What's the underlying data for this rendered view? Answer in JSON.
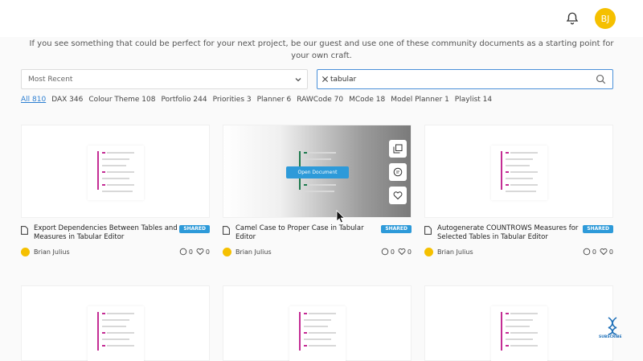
{
  "header": {
    "bell_icon": "bell-icon",
    "avatar_initials": "BJ"
  },
  "intro": "If you see something that could be perfect for your next project, be our guest and use one of these community documents as a starting point for your own craft.",
  "sort_select": {
    "value": "Most Recent"
  },
  "search": {
    "value": "tabular"
  },
  "filters": [
    {
      "label": "All 810",
      "active": true
    },
    {
      "label": "DAX 346"
    },
    {
      "label": "Colour Theme 108"
    },
    {
      "label": "Portfolio 244"
    },
    {
      "label": "Priorities 3"
    },
    {
      "label": "Planner 6"
    },
    {
      "label": "RAWCode 70"
    },
    {
      "label": "MCode 18"
    },
    {
      "label": "Model Planner 1"
    },
    {
      "label": "Playlist 14"
    }
  ],
  "cards": [
    {
      "title": "Export Dependencies Between Tables and Measures in Tabular Editor",
      "badge": "SHARED",
      "author": "Brian Julius",
      "comments": "0",
      "likes": "0"
    },
    {
      "title": "Camel Case to Proper Case in Tabular Editor",
      "badge": "SHARED",
      "author": "Brian Julius",
      "comments": "0",
      "likes": "0",
      "open_label": "Open Document"
    },
    {
      "title": "Autogenerate COUNTROWS Measures for Selected Tables in Tabular Editor",
      "badge": "SHARED",
      "author": "Brian Julius",
      "comments": "0",
      "likes": "0"
    }
  ],
  "subscribe": {
    "label": "SUBSCRIBE"
  },
  "colors": {
    "accent": "#2d9ad9",
    "avatar": "#f5c000",
    "doc_accent": "#c42d94",
    "hover_accent": "#1e7a4e"
  }
}
